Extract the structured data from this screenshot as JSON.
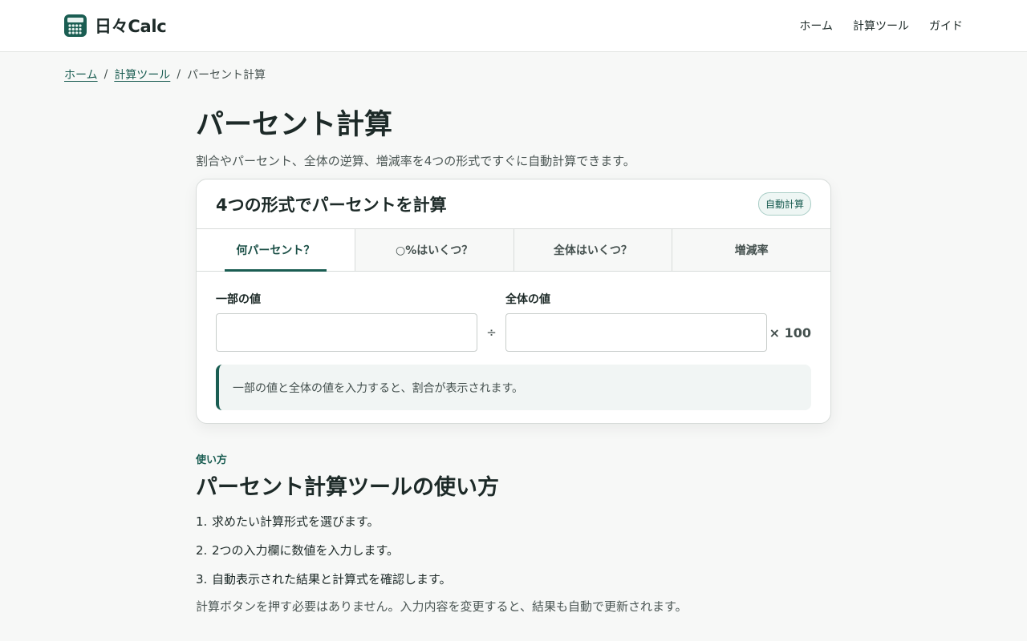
{
  "header": {
    "brand_name": "日々Calc",
    "nav": [
      "ホーム",
      "計算ツール",
      "ガイド"
    ]
  },
  "breadcrumb": {
    "home": "ホーム",
    "tools": "計算ツール",
    "current": "パーセント計算",
    "separator": "/"
  },
  "page": {
    "title": "パーセント計算",
    "lead": "割合やパーセント、全体の逆算、増減率を4つの形式ですぐに自動計算できます。"
  },
  "calculator": {
    "title": "4つの形式でパーセントを計算",
    "badge": "自動計算",
    "tabs": [
      "何パーセント？",
      "○%はいくつ？",
      "全体はいくつ？",
      "増減率"
    ],
    "active_tab": 0,
    "field1_label": "一部の値",
    "field1_value": "",
    "field2_label": "全体の値",
    "field2_value": "",
    "operator": "÷",
    "multiplier": "× 100",
    "result_message": "一部の値と全体の値を入力すると、割合が表示されます。"
  },
  "howto": {
    "kicker": "使い方",
    "title": "パーセント計算ツールの使い方",
    "steps": [
      {
        "num": "1.",
        "text": "求めたい計算形式を選びます。"
      },
      {
        "num": "2.",
        "text": "2つの入力欄に数値を入力します。"
      },
      {
        "num": "3.",
        "text": "自動表示された結果と計算式を確認します。"
      }
    ],
    "note": "計算ボタンを押す必要はありません。入力内容を変更すると、結果も自動で更新されます。"
  },
  "colors": {
    "accent": "#1a5d52",
    "background": "#f7f8f7"
  }
}
